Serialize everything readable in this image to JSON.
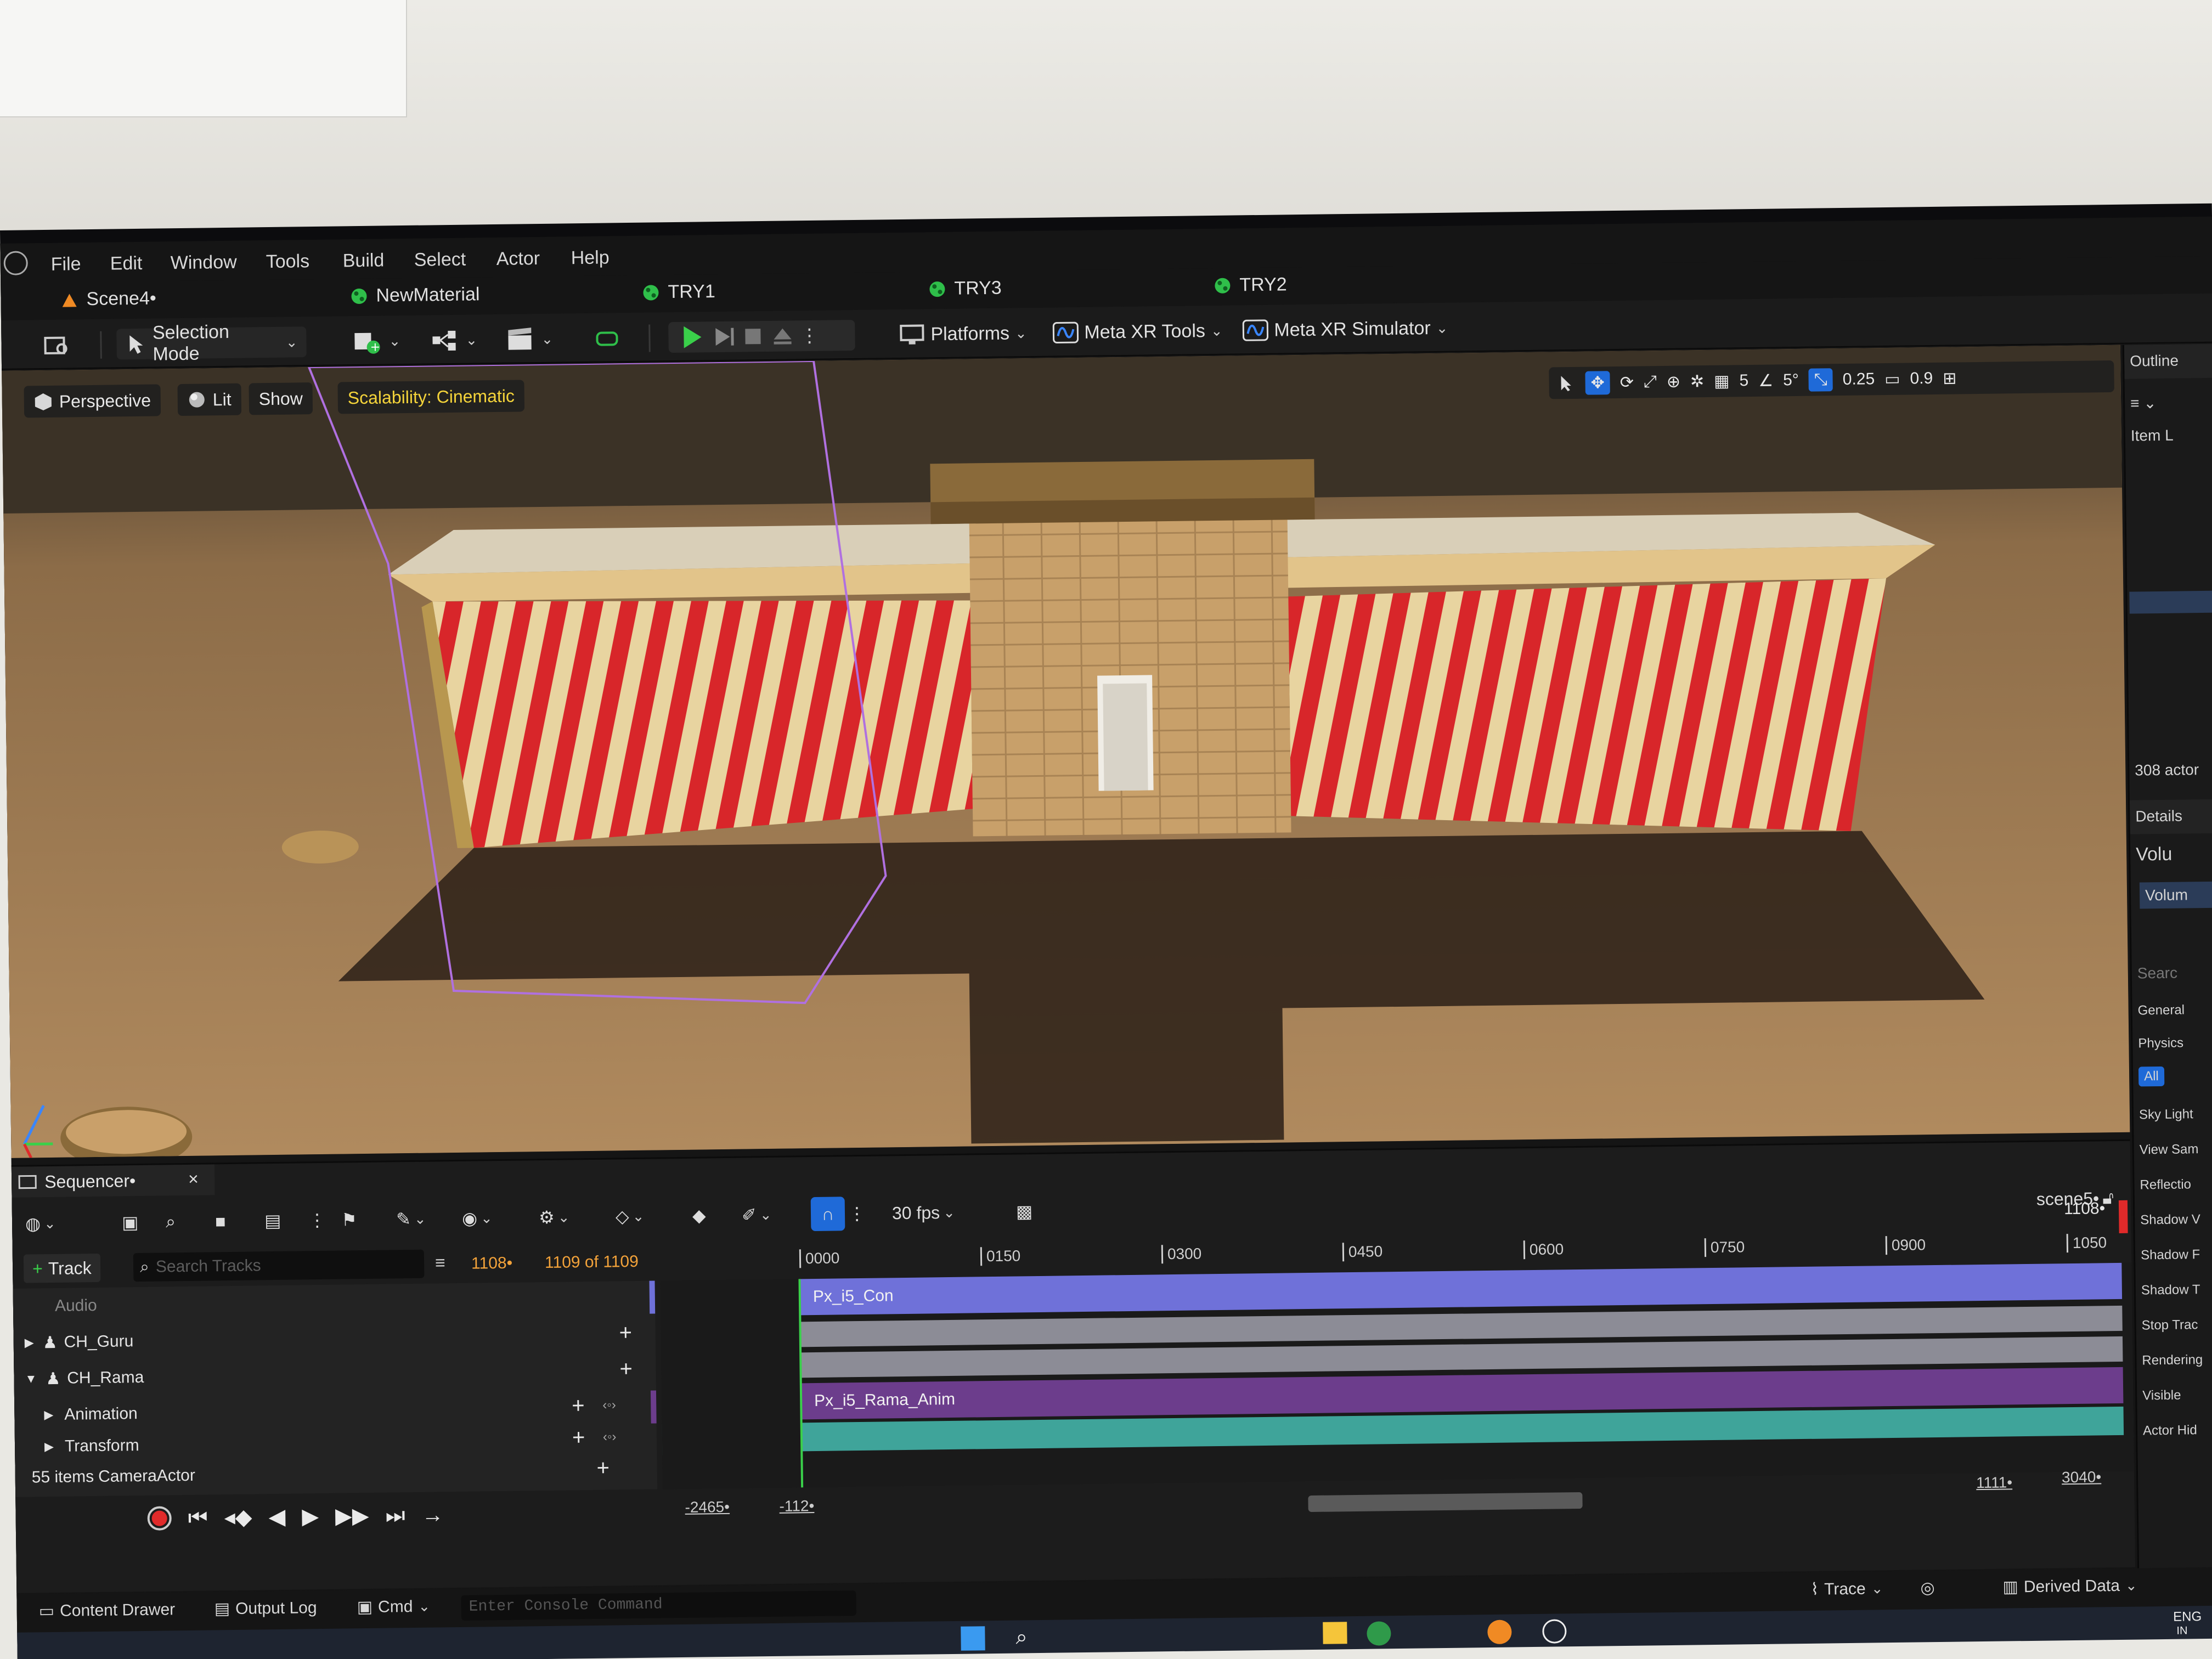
{
  "menu": [
    "File",
    "Edit",
    "Window",
    "Tools",
    "Build",
    "Select",
    "Actor",
    "Help"
  ],
  "tabs": [
    {
      "label": "Scene4•",
      "icon": "level-icon"
    },
    {
      "label": "NewMaterial",
      "icon": "material-icon"
    },
    {
      "label": "TRY1",
      "icon": "material-icon"
    },
    {
      "label": "TRY3",
      "icon": "material-icon"
    },
    {
      "label": "TRY2",
      "icon": "material-icon"
    }
  ],
  "toolbar": {
    "selection_mode": "Selection Mode",
    "platforms": "Platforms",
    "meta_xr_tools": "Meta XR Tools",
    "meta_xr_simulator": "Meta XR Simulator"
  },
  "viewport": {
    "perspective": "Perspective",
    "lit": "Lit",
    "show": "Show",
    "scalability": "Scalability: Cinematic",
    "grid_snap": "5",
    "rotation_snap": "5°",
    "scale_snap": "0.25",
    "camera_speed": "0.9"
  },
  "outliner": {
    "title": "Outline",
    "item_label": "Item L",
    "actor_count": "308 actor"
  },
  "details": {
    "title": "Details",
    "selected": "Volu",
    "component": "Volum",
    "search": "Searc",
    "filters": [
      "General",
      "Physics",
      "All"
    ],
    "props": [
      "Sky Light",
      "View Sam",
      "Reflectio",
      "Shadow V",
      "Shadow F",
      "Shadow T",
      "Stop Trac",
      "Rendering",
      "Visible",
      "Actor Hid"
    ]
  },
  "sequencer": {
    "tab_label": "Sequencer•",
    "fps": "30 fps",
    "sequence_name": "scene5•",
    "add_track": "Track",
    "search_placeholder": "Search Tracks",
    "current_frame": "1108•",
    "frame_count": "1109 of 1109",
    "end_frame": "1108•",
    "ticks": [
      "0000",
      "0150",
      "0300",
      "0450",
      "0600",
      "0750",
      "0900",
      "1050"
    ],
    "tracks": [
      {
        "label": "Audio",
        "indent": 1
      },
      {
        "label": "CH_Guru",
        "indent": 0
      },
      {
        "label": "CH_Rama",
        "indent": 0
      },
      {
        "label": "Animation",
        "indent": 1
      },
      {
        "label": "Transform",
        "indent": 1
      },
      {
        "label": "CameraActor",
        "indent": 1
      }
    ],
    "items_count": "55 items",
    "sections": [
      "Px_i5_Con",
      "Px_i5_Rama_Anim"
    ],
    "range_start": "-2465•",
    "range_start2": "-112•",
    "range_end": "1111•",
    "range_end2": "3040•"
  },
  "status": {
    "content_drawer": "Content Drawer",
    "output_log": "Output Log",
    "cmd": "Cmd",
    "console_placeholder": "Enter Console Command",
    "trace": "Trace",
    "derived_data": "Derived Data",
    "lang_top": "ENG",
    "lang_bottom": "IN"
  },
  "colors": {
    "accent_blue": "#1f6ad8",
    "sequencer_orange": "#f2a23a",
    "playhead_green": "#3ad04a",
    "section_blue": "#6f71d9",
    "section_purple": "#6c3d8c",
    "section_teal": "#3fa49a",
    "stripe_red": "#d8262a",
    "stripe_cream": "#e8d4a0"
  }
}
